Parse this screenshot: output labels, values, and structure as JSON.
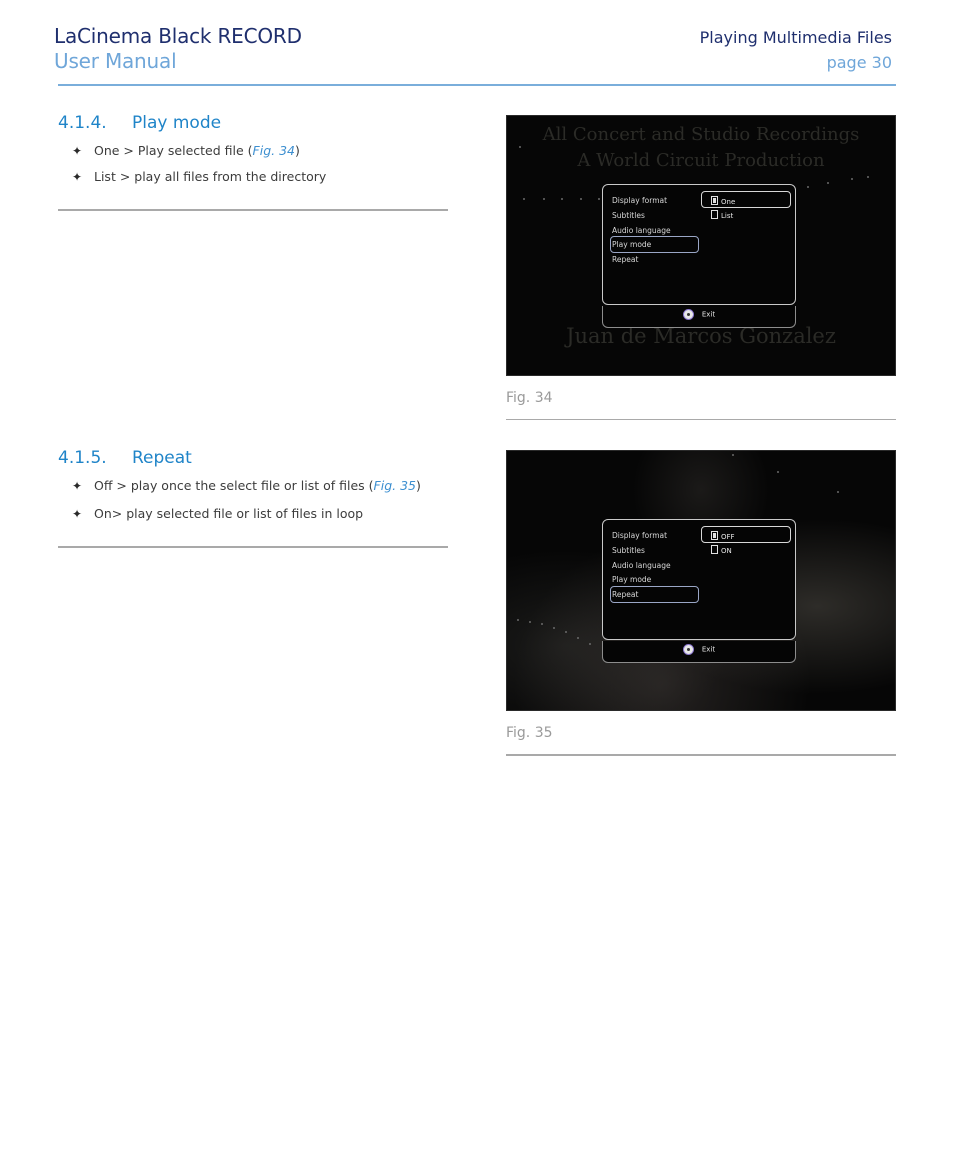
{
  "header": {
    "product": "LaCinema Black RECORD",
    "doc_type": "User Manual",
    "chapter": "Playing Multimedia Files",
    "page": "page 30"
  },
  "sections": [
    {
      "number": "4.1.4.",
      "title": "Play mode",
      "bullets": [
        {
          "pre": "One > Play selected file (",
          "ref": "Fig. 34",
          "post": ")"
        },
        {
          "pre": "List > play all files from the directory",
          "ref": "",
          "post": ""
        }
      ],
      "figure": {
        "caption": "Fig. 34",
        "background_text": [
          "All Concert and Studio Recordings",
          "A World Circuit Production",
          "Juan de Marcos Gonzalez"
        ],
        "menu_items": [
          "Display format",
          "Subtitles",
          "Audio language",
          "Play mode",
          "Repeat"
        ],
        "highlighted_item": "Play mode",
        "options": [
          {
            "label": "One",
            "checked": true
          },
          {
            "label": "List",
            "checked": false
          }
        ],
        "exit_label": "Exit",
        "icon": "ok-button-icon"
      }
    },
    {
      "number": "4.1.5.",
      "title": "Repeat",
      "bullets": [
        {
          "pre": "Off > play once the select file or list of files (",
          "ref": "Fig. 35",
          "post": ")"
        },
        {
          "pre": "On> play selected file or list of files in loop",
          "ref": "",
          "post": ""
        }
      ],
      "figure": {
        "caption": "Fig. 35",
        "background_text": [],
        "menu_items": [
          "Display format",
          "Subtitles",
          "Audio language",
          "Play mode",
          "Repeat"
        ],
        "highlighted_item": "Repeat",
        "options": [
          {
            "label": "OFF",
            "checked": true
          },
          {
            "label": "ON",
            "checked": false
          }
        ],
        "exit_label": "Exit",
        "icon": "ok-button-icon"
      }
    }
  ],
  "bullet_glyph": "✦",
  "colors": {
    "title_navy": "#1f2f6e",
    "accent_blue": "#6fa6d9",
    "section_blue": "#1f84c8",
    "rule_gray": "#a9a9a9"
  }
}
